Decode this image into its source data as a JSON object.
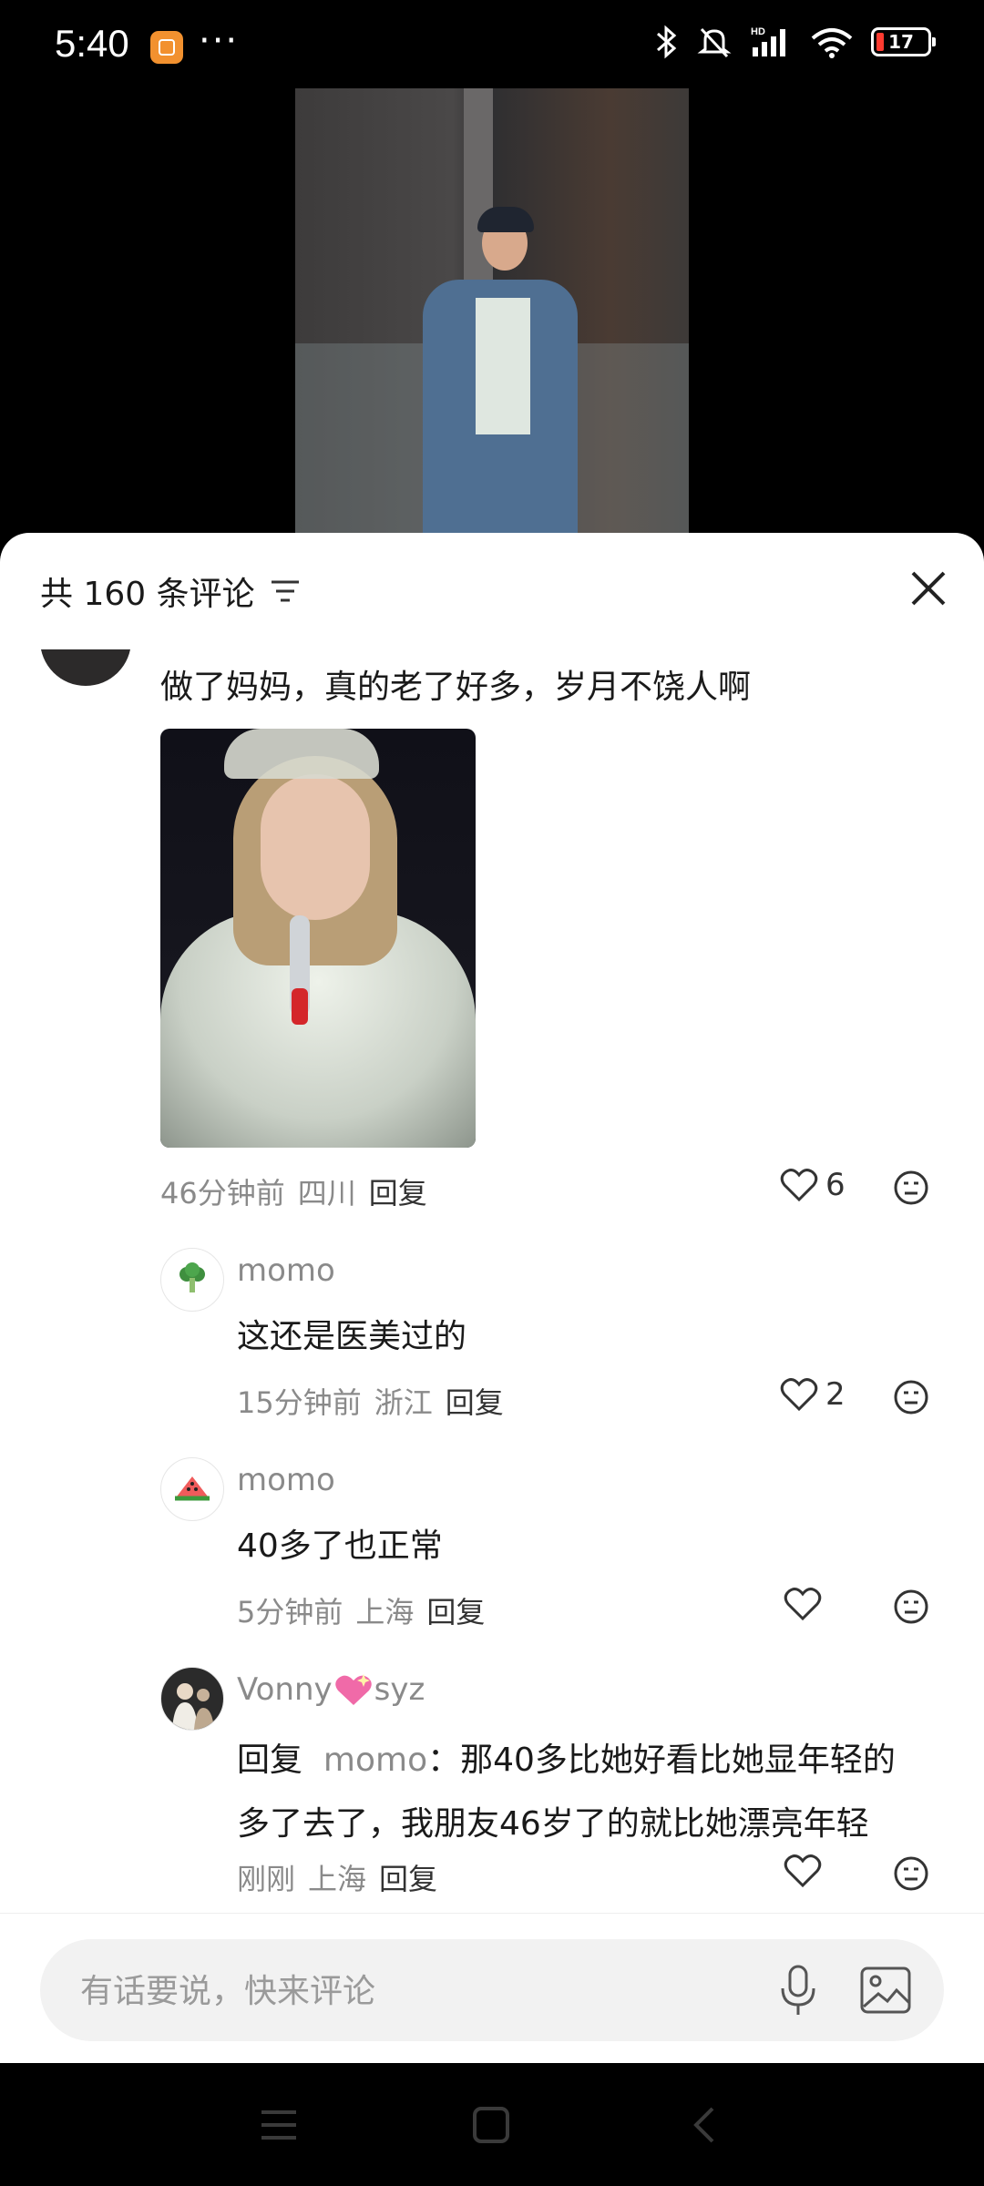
{
  "status_bar": {
    "time": "5:40",
    "dots": "···",
    "battery": "17"
  },
  "sheet": {
    "header_title": "共 160 条评论"
  },
  "comments": {
    "main": {
      "text": "做了妈妈，真的老了好多，岁月不饶人啊",
      "time": "46分钟前",
      "location": "四川",
      "reply_label": "回复",
      "likes": "6"
    },
    "replies": [
      {
        "user": "momo",
        "text": "这还是医美过的",
        "time": "15分钟前",
        "location": "浙江",
        "reply_label": "回复",
        "likes": "2"
      },
      {
        "user": "momo",
        "text": "40多了也正常",
        "time": "5分钟前",
        "location": "上海",
        "reply_label": "回复",
        "likes": ""
      },
      {
        "user_prefix": "Vonny",
        "user_suffix": "syz",
        "reply_to_label": "回复",
        "reply_to_user": "momo",
        "text_line1": "：那40多比她好看比她显年轻的",
        "text_line2": "多了去了，我朋友46岁了的就比她漂亮年轻",
        "time": "刚刚",
        "location": "上海",
        "reply_label": "回复",
        "likes": ""
      }
    ]
  },
  "input": {
    "placeholder": "有话要说，快来评论"
  }
}
